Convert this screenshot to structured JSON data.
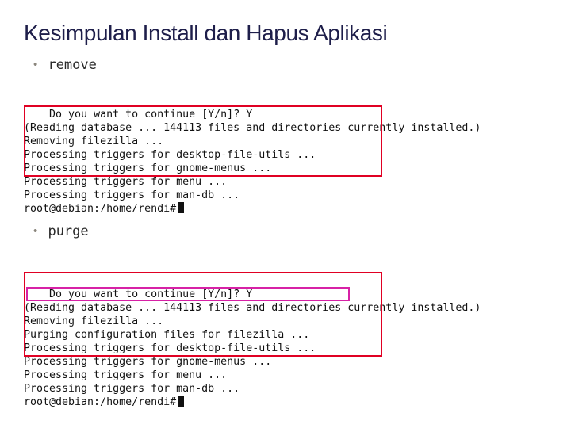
{
  "title": "Kesimpulan Install dan Hapus Aplikasi",
  "section1": {
    "label": "remove",
    "term": {
      "l1": "Do you want to continue [Y/n]? Y",
      "l2": "(Reading database ... 144113 files and directories currently installed.)",
      "l3": "Removing filezilla ...",
      "l4": "Processing triggers for desktop-file-utils ...",
      "l5": "Processing triggers for gnome-menus ...",
      "l6": "Processing triggers for menu ...",
      "l7": "Processing triggers for man-db ...",
      "l8": "root@debian:/home/rendi#"
    }
  },
  "section2": {
    "label": "purge",
    "term": {
      "l1": "Do you want to continue [Y/n]? Y",
      "l2": "(Reading database ... 144113 files and directories currently installed.)",
      "l3": "Removing filezilla ...",
      "l4": "Purging configuration files for filezilla ...",
      "l5": "Processing triggers for desktop-file-utils ...",
      "l6": "Processing triggers for gnome-menus ...",
      "l7": "Processing triggers for menu ...",
      "l8": "Processing triggers for man-db ...",
      "l9": "root@debian:/home/rendi#"
    }
  }
}
